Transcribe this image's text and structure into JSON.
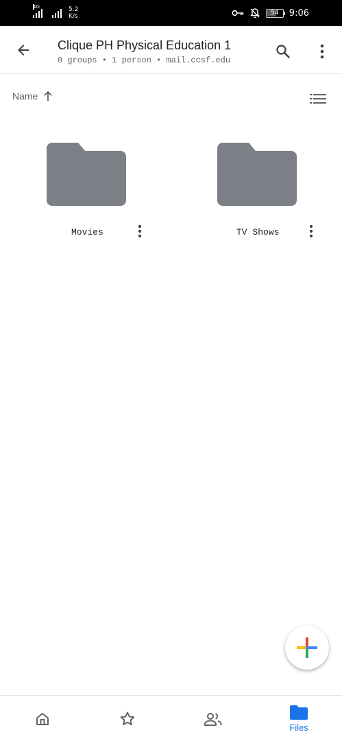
{
  "status_bar": {
    "network_type": "4G",
    "speed_value": "5.2",
    "speed_unit": "K/s",
    "battery": "54",
    "time": "9:06"
  },
  "app_bar": {
    "title": "Clique PH Physical Education 1",
    "subtitle": "0 groups • 1 person • mail.ccsf.edu",
    "icons": [
      "arrow-back",
      "search",
      "more-vert"
    ]
  },
  "sort": {
    "label": "Name",
    "direction": "ascending"
  },
  "items": [
    {
      "name": "Movies",
      "type": "folder"
    },
    {
      "name": "TV Shows",
      "type": "folder"
    }
  ],
  "bottom_nav": {
    "items": [
      {
        "id": "home",
        "icon": "home"
      },
      {
        "id": "starred",
        "icon": "star"
      },
      {
        "id": "shared",
        "icon": "people"
      },
      {
        "id": "files",
        "icon": "folder",
        "label": "Files",
        "active": true
      }
    ]
  },
  "colors": {
    "accent": "#1a73e8",
    "folder": "#7d7f86",
    "icon": "#5f6368",
    "fab_plus": [
      "#4285f4",
      "#ea4335",
      "#fbbc04",
      "#34a853"
    ]
  }
}
